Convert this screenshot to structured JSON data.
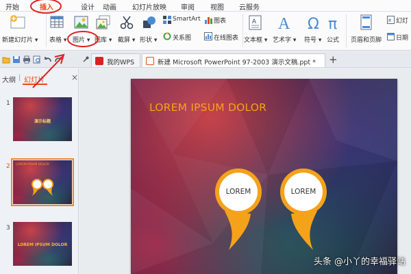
{
  "menu": {
    "tabs": [
      "开始",
      "插入",
      "设计",
      "动画",
      "幻灯片放映",
      "审阅",
      "视图",
      "云服务"
    ],
    "active_tab": "插入"
  },
  "ribbon": {
    "new_slide": "新建幻灯片 ▾",
    "table": "表格 ▾",
    "picture": "图片 ▾",
    "gallery": "图库 ▾",
    "screenshot": "截屏 ▾",
    "shapes": "形状 ▾",
    "smartart": "SmartArt",
    "relation": "关系图",
    "chart": "图表",
    "online_chart": "在线图表",
    "textbox": "文本框 ▾",
    "wordart": "艺术字 ▾",
    "symbol": "符号 ▾",
    "formula": "公式",
    "header_footer": "页眉和页脚",
    "slide_number": "幻灯",
    "date": "日期"
  },
  "doc_tabs": [
    {
      "label": "我的WPS",
      "active": false
    },
    {
      "label": "新建 Microsoft PowerPoint 97-2003 演示文稿.ppt *",
      "active": true
    }
  ],
  "add_tab": "+",
  "pane": {
    "tabs": [
      "大纲",
      "幻灯片"
    ],
    "active": "幻灯片",
    "close": "×",
    "thumbnails": [
      {
        "number": "1",
        "text": "演示标题"
      },
      {
        "number": "2",
        "text": "LOREM IPSUM DOLOR"
      },
      {
        "number": "3",
        "text": "LOREM IPSUM DOLOR"
      }
    ]
  },
  "slide": {
    "title": "LOREM IPSUM DOLOR",
    "pins": [
      "LOREM",
      "LOREM"
    ]
  },
  "watermark": "头条 @小丫的幸福驿站",
  "colors": {
    "accent": "#e64a19",
    "title_orange": "#f3a31c",
    "pin_orange": "#f5a21b",
    "annotation_red": "#e02020"
  }
}
